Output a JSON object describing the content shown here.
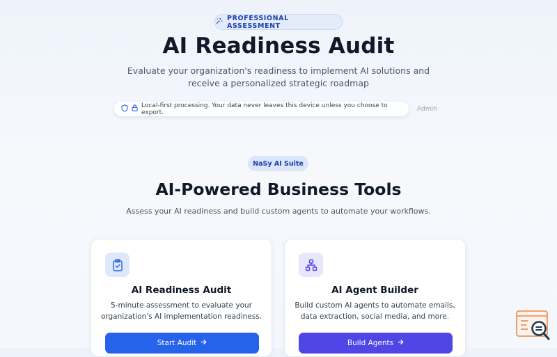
{
  "header": {
    "badge": "PROFESSIONAL ASSESSMENT",
    "badge_icon": "sparkles-icon",
    "title": "AI Readiness Audit",
    "subtitle_line1": "Evaluate your organization's readiness to implement AI solutions and",
    "subtitle_line2": "receive a personalized strategic roadmap"
  },
  "privacy": {
    "icons": [
      "shield-icon",
      "lock-icon"
    ],
    "text": "Local-first processing. Your data never leaves this device unless you choose to export.",
    "admin_link": "Admin"
  },
  "suite": {
    "badge": "NaSy AI Suite",
    "title": "AI-Powered Business Tools",
    "subtitle": "Assess your AI readiness and build custom agents to automate your workflows."
  },
  "cards": [
    {
      "icon": "clipboard-check-icon",
      "title": "AI Readiness Audit",
      "desc_line1": "5-minute assessment to evaluate your",
      "desc_line2": "organization's AI implementation readiness.",
      "button": "Start Audit",
      "accent": "#2563eb"
    },
    {
      "icon": "network-icon",
      "title": "AI Agent Builder",
      "desc_line1": "Build custom AI agents to automate emails,",
      "desc_line2": "data extraction, social media, and more.",
      "button": "Build Agents",
      "accent": "#4f46e5"
    }
  ],
  "colors": {
    "primary": "#2563eb",
    "indigo": "#4f46e5",
    "badge_text": "#1e40af",
    "background": "#eef3fb"
  }
}
